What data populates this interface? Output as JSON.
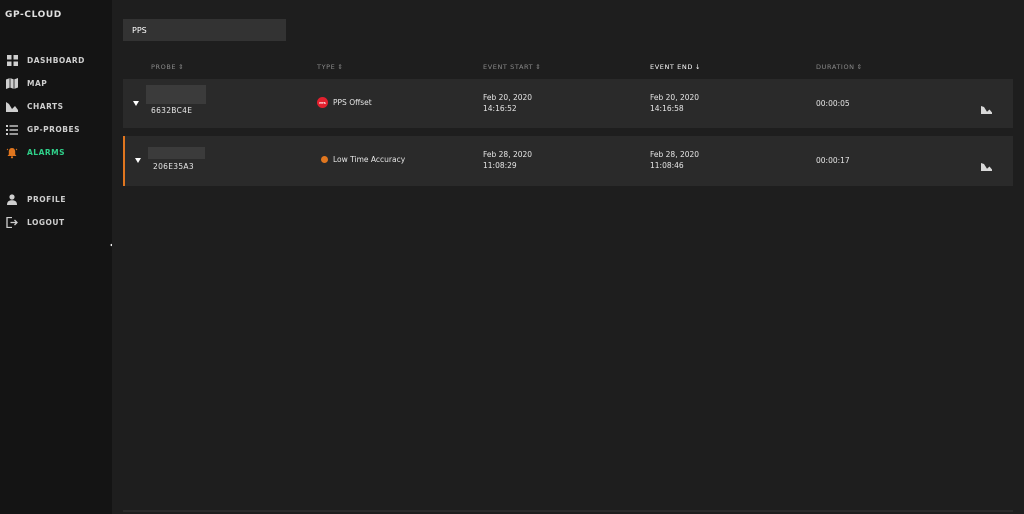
{
  "app": {
    "title": "GP-CLOUD"
  },
  "sidebar": {
    "items": [
      {
        "label": "DASHBOARD",
        "icon": "dashboard-icon"
      },
      {
        "label": "MAP",
        "icon": "map-icon"
      },
      {
        "label": "CHARTS",
        "icon": "area-chart-icon"
      },
      {
        "label": "GP-PROBES",
        "icon": "list-icon"
      },
      {
        "label": "ALARMS",
        "icon": "bell-icon",
        "active": true
      }
    ],
    "account": [
      {
        "label": "PROFILE",
        "icon": "user-icon"
      },
      {
        "label": "LOGOUT",
        "icon": "logout-icon"
      }
    ]
  },
  "search": {
    "value": "PPS"
  },
  "table": {
    "columns": [
      {
        "label": "PROBE",
        "sort": "⇕"
      },
      {
        "label": "TYPE",
        "sort": "⇕"
      },
      {
        "label": "EVENT START",
        "sort": "⇕"
      },
      {
        "label": "EVENT END",
        "sort": "↓",
        "sorted": true
      },
      {
        "label": "DURATION",
        "sort": "⇕"
      }
    ],
    "rows": [
      {
        "probe_id": "6632BC4E",
        "type": "PPS Offset",
        "type_badge": "PPS",
        "type_color": "#e3202e",
        "start_date": "Feb 20, 2020",
        "start_time": "14:16:52",
        "end_date": "Feb 20, 2020",
        "end_time": "14:16:58",
        "duration": "00:00:05"
      },
      {
        "probe_id": "206E35A3",
        "type": "Low Time Accuracy",
        "type_color": "#e0761f",
        "start_date": "Feb 28, 2020",
        "start_time": "11:08:29",
        "end_date": "Feb 28, 2020",
        "end_time": "11:08:46",
        "duration": "00:00:17"
      }
    ]
  },
  "colors": {
    "accent_active": "#2fd18a",
    "alarm_warning": "#e0761f",
    "alarm_error": "#e3202e"
  }
}
